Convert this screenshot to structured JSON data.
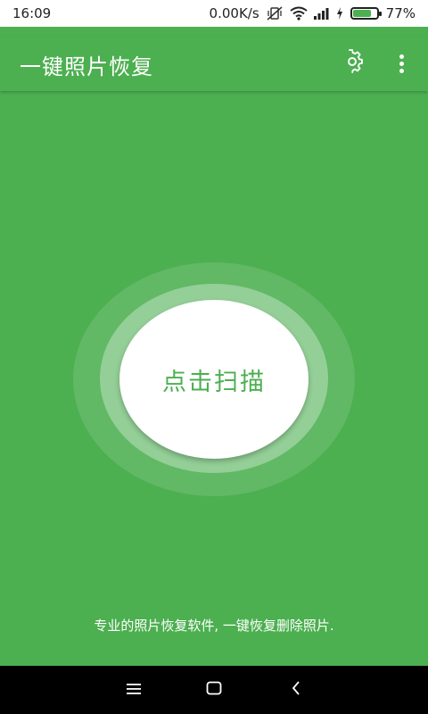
{
  "status_bar": {
    "time": "16:09",
    "network_speed": "0.00K/s",
    "battery_percent": "77%",
    "battery_level": 0.77,
    "icons": [
      "vibrate-off-icon",
      "wifi-icon",
      "signal-icon",
      "charging-icon",
      "battery-icon"
    ]
  },
  "app_bar": {
    "title": "一键照片恢复",
    "settings_icon": "gear-icon",
    "menu_icon": "more-vertical-icon"
  },
  "main": {
    "scan_button_label": "点击扫描",
    "description": "专业的照片恢复软件, 一键恢复删除照片."
  },
  "nav_bar": {
    "icons": [
      "menu-icon",
      "home-square-icon",
      "back-icon"
    ]
  },
  "colors": {
    "primary": "#4CAF50",
    "status_bar_bg": "#FFFFFF",
    "nav_bar_bg": "#000000",
    "scan_button_bg": "#FFFFFF"
  }
}
